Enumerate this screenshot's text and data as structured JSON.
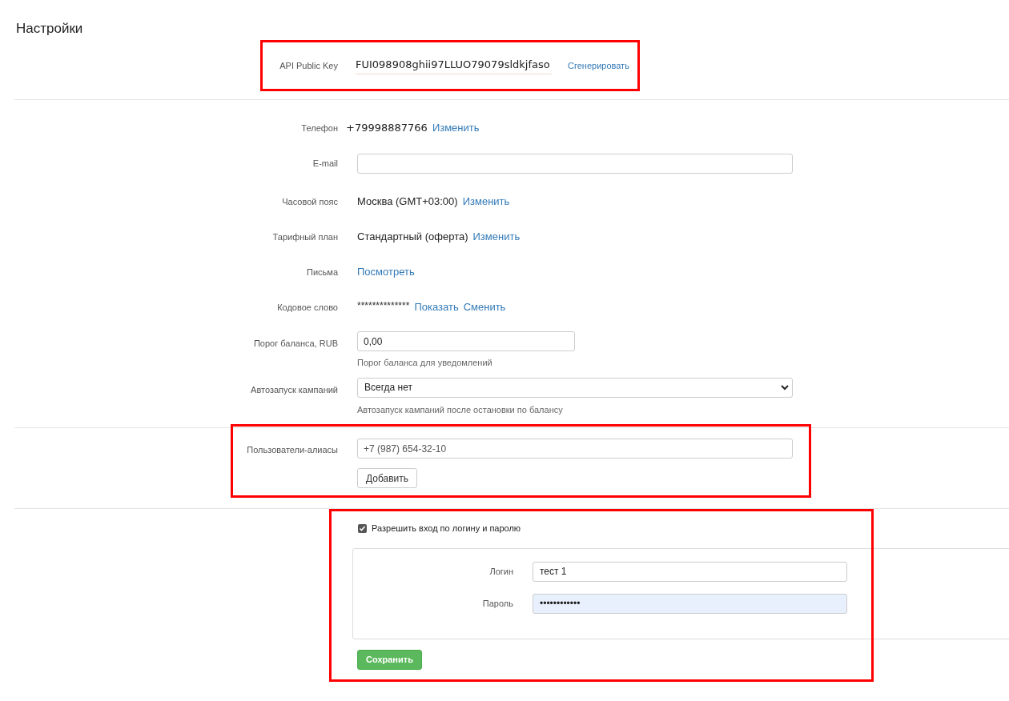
{
  "page_title": "Настройки",
  "api": {
    "highlighted": true,
    "label": "API Public Key",
    "value": "FUI098908ghii97LLUO79079sldkjfaso",
    "link": "Сгенерировать"
  },
  "profile": {
    "rows": [
      {
        "kind": "text_links",
        "label": "Телефон",
        "value": "+79998887766",
        "links": [
          "Изменить"
        ]
      },
      {
        "kind": "input",
        "label": "E-mail",
        "value": ""
      },
      {
        "kind": "text_links",
        "label": "Часовой пояс",
        "value": "Москва (GMT+03:00)",
        "links": [
          "Изменить"
        ]
      },
      {
        "kind": "text_links",
        "label": "Тарифный план",
        "value": "Стандартный (оферта)",
        "links": [
          "Изменить"
        ]
      },
      {
        "kind": "text_links",
        "label": "Письма",
        "links": [
          "Посмотреть"
        ]
      },
      {
        "kind": "masked",
        "label": "Кодовое слово",
        "value": "**************",
        "links": [
          "Показать",
          "Сменить"
        ]
      },
      {
        "kind": "input",
        "label": "Порог баланса, RUB",
        "value": "0,00",
        "help": "Порог баланса для уведомлений"
      },
      {
        "kind": "select",
        "label": "Автозапуск кампаний",
        "value": "Всегда нет",
        "help": "Автозапуск кампаний после остановки по балансу"
      }
    ]
  },
  "aliases": {
    "highlighted": true,
    "label": "Пользователи-алиасы",
    "placeholder": "+7 (987) 654-32-10",
    "button": "Добавить"
  },
  "login": {
    "highlighted": true,
    "checkbox": {
      "label": "Разрешить вход по логину и паролю",
      "checked": true
    },
    "fields": [
      {
        "label": "Логин",
        "value": "тест 1",
        "autofilled": false
      },
      {
        "label": "Пароль",
        "value": "••••••••••••",
        "autofilled": true
      }
    ],
    "save_button": "Сохранить"
  }
}
